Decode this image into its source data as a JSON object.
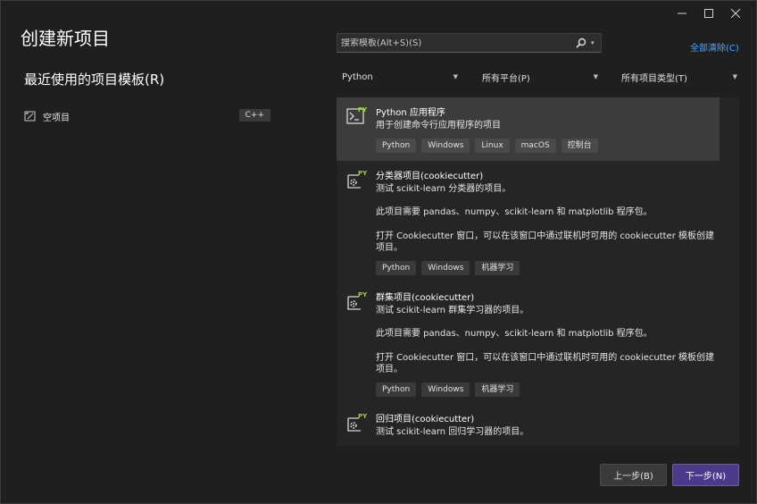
{
  "page_title": "创建新项目",
  "window_controls": {
    "minimize": "minimize-icon",
    "maximize": "maximize-icon",
    "close": "close-icon"
  },
  "recent": {
    "heading": "最近使用的项目模板(R)",
    "items": [
      {
        "label": "空项目",
        "language": "C++",
        "icon": "empty-project-icon"
      }
    ]
  },
  "search": {
    "placeholder": "搜索模板(Alt+S)(S)",
    "value": ""
  },
  "clear_all": "全部清除(C)",
  "filters": {
    "language": "Python",
    "platform": "所有平台(P)",
    "project_type": "所有项目类型(T)"
  },
  "templates": [
    {
      "title": "Python 应用程序",
      "description": [
        "用于创建命令行应用程序的项目"
      ],
      "tags": [
        "Python",
        "Windows",
        "Linux",
        "macOS",
        "控制台"
      ],
      "selected": true,
      "icon": "python-app-icon"
    },
    {
      "title": "分类器项目(cookiecutter)",
      "description": [
        "测试 scikit-learn 分类器的项目。",
        "此项目需要 pandas、numpy、scikit-learn 和 matplotlib 程序包。",
        "打开 Cookiecutter 窗口，可以在该窗口中通过联机时可用的 cookiecutter 模板创建项目。"
      ],
      "tags": [
        "Python",
        "Windows",
        "机器学习"
      ],
      "icon": "python-cookiecutter-icon"
    },
    {
      "title": "群集项目(cookiecutter)",
      "description": [
        "测试 scikit-learn 群集学习器的项目。",
        "此项目需要 pandas、numpy、scikit-learn 和 matplotlib 程序包。",
        "打开 Cookiecutter 窗口，可以在该窗口中通过联机时可用的 cookiecutter 模板创建项目。"
      ],
      "tags": [
        "Python",
        "Windows",
        "机器学习"
      ],
      "icon": "python-cookiecutter-icon"
    },
    {
      "title": "回归项目(cookiecutter)",
      "description": [
        "测试 scikit-learn 回归学习器的项目。"
      ],
      "tags": [],
      "icon": "python-cookiecutter-icon"
    }
  ],
  "buttons": {
    "back": "上一步(B)",
    "next": "下一步(N)"
  },
  "colors": {
    "accent": "#4b3a8c",
    "link": "#4ea3ff",
    "python_green": "#9bd13b"
  }
}
